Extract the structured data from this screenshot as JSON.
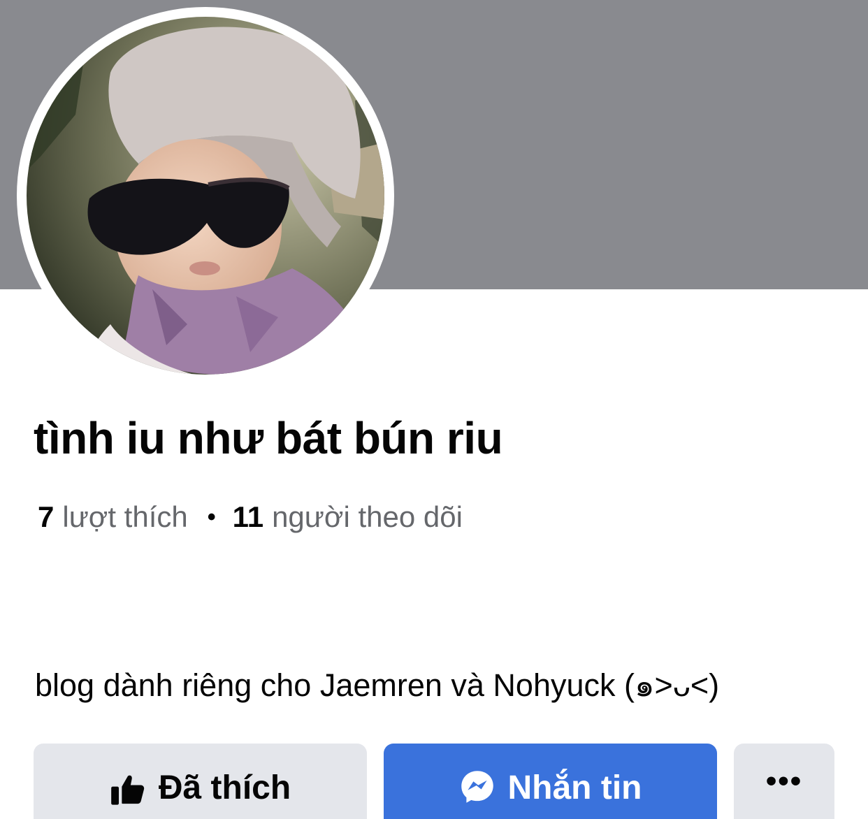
{
  "profile": {
    "name": "tình iu như bát bún riu",
    "likes_count": "7",
    "likes_label": "lượt thích",
    "separator": "•",
    "followers_count": "11",
    "followers_label": "người theo dõi",
    "bio": "blog dành riêng cho Jaemren và Nohyuck (๑˃ᴗ˂)"
  },
  "actions": {
    "liked_label": "Đã thích",
    "liked_icon": "thumbs-up-icon",
    "message_label": "Nhắn tin",
    "message_icon": "messenger-icon",
    "more_label": "•••",
    "more_icon": "more-options-icon"
  },
  "colors": {
    "cover": "#898a8f",
    "primary": "#3a72dc",
    "secondary_button": "#e4e6eb",
    "text_primary": "#050505",
    "text_secondary": "#65676b"
  }
}
